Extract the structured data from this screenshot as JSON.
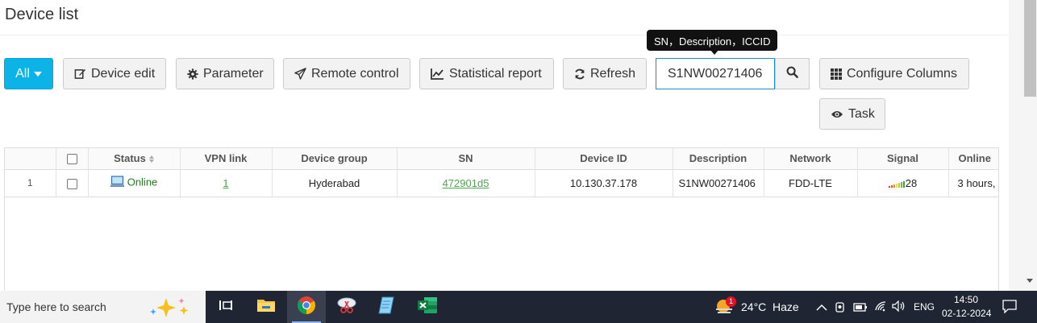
{
  "page": {
    "title": "Device list"
  },
  "toolbar": {
    "all_label": "All",
    "device_edit_label": "Device edit",
    "parameter_label": "Parameter",
    "remote_control_label": "Remote control",
    "statistical_report_label": "Statistical report",
    "refresh_label": "Refresh",
    "configure_columns_label": "Configure Columns",
    "task_label": "Task"
  },
  "search": {
    "value": "S1NW00271406",
    "tooltip": "SN，Description，ICCID"
  },
  "table": {
    "columns": [
      "Status",
      "VPN link",
      "Device group",
      "SN",
      "Device ID",
      "Description",
      "Network",
      "Signal",
      "Online"
    ],
    "rows": [
      {
        "index": "1",
        "status": "Online",
        "vpn_link": "1",
        "device_group": "Hyderabad",
        "sn": "472901d5",
        "device_id": "10.130.37.178",
        "description": "S1NW00271406",
        "network": "FDD-LTE",
        "signal": "28",
        "online": "3 hours,"
      }
    ]
  },
  "taskbar": {
    "search_placeholder": "Type here to search",
    "weather_temp": "24°C",
    "weather_desc": "Haze",
    "weather_badge": "1",
    "language": "ENG",
    "time": "14:50",
    "date": "02-12-2024"
  },
  "colors": {
    "accent": "#0bb3e6",
    "online_green": "#1a7f1a",
    "link_green": "#4ca84c",
    "taskbar": "#1f2533"
  }
}
